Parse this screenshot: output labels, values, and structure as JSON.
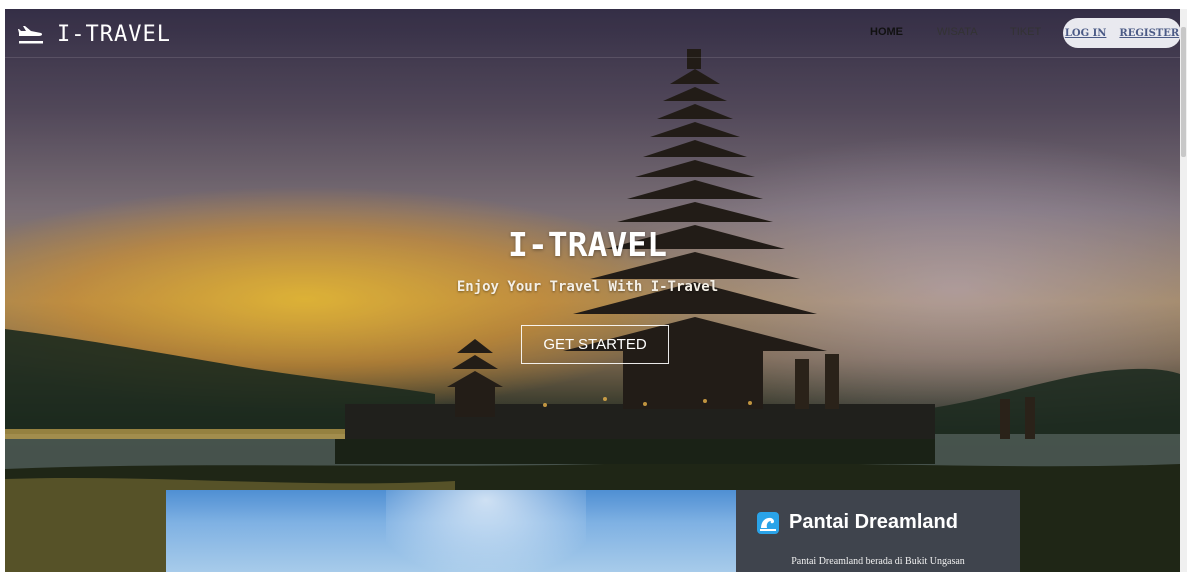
{
  "brand": {
    "name": "I-TRAVEL",
    "icon": "airplane-icon"
  },
  "nav": {
    "home": "HOME",
    "wisata": "WISATA",
    "tiket": "TIKET"
  },
  "auth": {
    "login": "LOG IN",
    "register": "REGISTER"
  },
  "hero": {
    "title": "I-TRAVEL",
    "subtitle": "Enjoy Your Travel With I-Travel",
    "cta": "GET STARTED"
  },
  "card": {
    "icon": "wave-icon",
    "title": "Pantai Dreamland",
    "description": "Pantai Dreamland berada di Bukit Ungasan"
  },
  "colors": {
    "card_bg": "#3f444d",
    "auth_bg": "#e9e9ef",
    "link": "#4b5a86"
  }
}
